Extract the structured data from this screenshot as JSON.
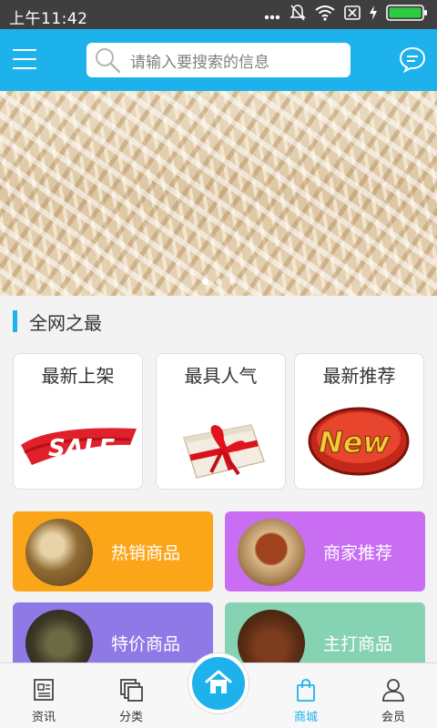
{
  "status_bar": {
    "time": "上午11:42"
  },
  "header": {
    "search_placeholder": "请输入要搜索的信息",
    "menu_icon": "hamburger-menu-icon",
    "chat_icon": "chat-bubble-icon",
    "accent_color": "#1eb2ec"
  },
  "banner": {
    "slide_count": 3,
    "active_slide": 1
  },
  "section": {
    "title": "全网之最"
  },
  "features": [
    {
      "title": "最新上架",
      "icon": "sale-banner-icon"
    },
    {
      "title": "最具人气",
      "icon": "gift-box-icon"
    },
    {
      "title": "最新推荐",
      "icon": "new-badge-icon"
    }
  ],
  "tiles": [
    {
      "label": "热销商品",
      "color": "#fba619"
    },
    {
      "label": "商家推荐",
      "color": "#c96ef2"
    },
    {
      "label": "特价商品",
      "color": "#8e79e7"
    },
    {
      "label": "主打商品",
      "color": "#86d3b4"
    }
  ],
  "bottom_nav": {
    "items": [
      {
        "label": "资讯",
        "icon": "news-icon"
      },
      {
        "label": "分类",
        "icon": "category-icon"
      },
      {
        "label": "商城",
        "icon": "shopping-bag-icon",
        "active": true
      },
      {
        "label": "会员",
        "icon": "user-icon"
      }
    ],
    "home_icon": "home-icon"
  }
}
